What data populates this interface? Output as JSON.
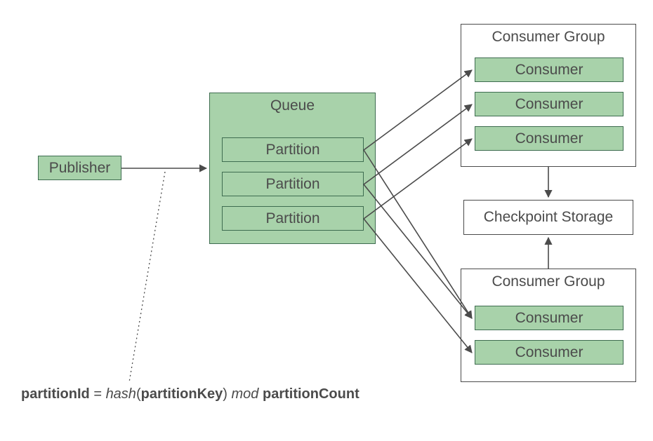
{
  "publisher": {
    "label": "Publisher"
  },
  "queue": {
    "title": "Queue",
    "partitions": [
      "Partition",
      "Partition",
      "Partition"
    ]
  },
  "consumer_groups": [
    {
      "title": "Consumer Group",
      "consumers": [
        "Consumer",
        "Consumer",
        "Consumer"
      ]
    },
    {
      "title": "Consumer Group",
      "consumers": [
        "Consumer",
        "Consumer"
      ]
    }
  ],
  "checkpoint": {
    "label": "Checkpoint Storage"
  },
  "formula": {
    "lhs": "partitionId",
    "eq": " = ",
    "fn": "hash",
    "arg": "partitionKey",
    "op": " mod ",
    "rhs": "partitionCount"
  },
  "colors": {
    "green_fill": "#a8d2aa",
    "green_border": "#3e6c50",
    "text": "#4b4b4b",
    "line": "#4b4b4b"
  }
}
